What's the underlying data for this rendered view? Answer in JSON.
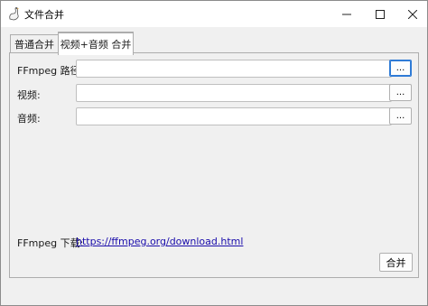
{
  "window": {
    "title": "文件合并"
  },
  "tabs": [
    {
      "label": "普通合并",
      "active": false
    },
    {
      "label": "视频+音频 合并",
      "active": true
    }
  ],
  "form": {
    "ffmpeg_path": {
      "label": "FFmpeg 路径:",
      "value": "",
      "browse": "..."
    },
    "video": {
      "label": "视频:",
      "value": "",
      "browse": "..."
    },
    "audio": {
      "label": "音频:",
      "value": "",
      "browse": "..."
    }
  },
  "ffmpeg_download": {
    "label": "FFmpeg 下载:",
    "link": "https://ffmpeg.org/download.html"
  },
  "actions": {
    "merge_label": "合并"
  },
  "colors": {
    "accent": "#2f7bd6",
    "link": "#1a0dab",
    "window_bg": "#f0f0f0"
  }
}
